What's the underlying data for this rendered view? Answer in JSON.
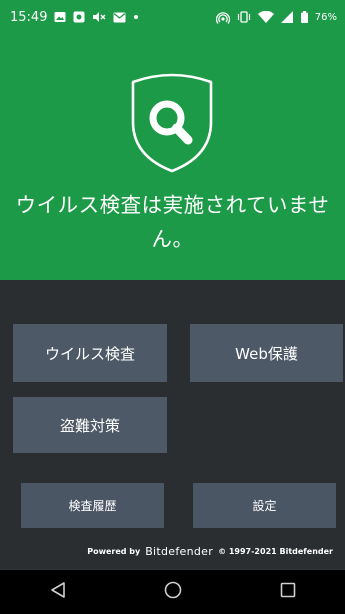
{
  "status_bar": {
    "time": "15:49",
    "battery": "76%",
    "left_icons": [
      "image-icon",
      "app-icon",
      "mute-icon",
      "mail-icon",
      "dot-icon"
    ],
    "right_icons": [
      "hotspot-icon",
      "vibrate-icon",
      "wifi-icon",
      "signal-icon",
      "battery-icon"
    ]
  },
  "hero": {
    "message": "ウイルス検査は実施されていません。",
    "icon": "search-shield-icon",
    "color": "#1c9a48"
  },
  "tiles": {
    "virus_scan": "ウイルス検査",
    "web_protection": "Web保護",
    "anti_theft": "盗難対策",
    "scan_history": "検査履歴",
    "settings": "設定"
  },
  "footer": {
    "powered_by": "Powered by",
    "brand": "Bitdefender",
    "copyright": "© 1997-2021 Bitdefender"
  },
  "nav": [
    "back-icon",
    "home-icon",
    "recents-icon"
  ]
}
